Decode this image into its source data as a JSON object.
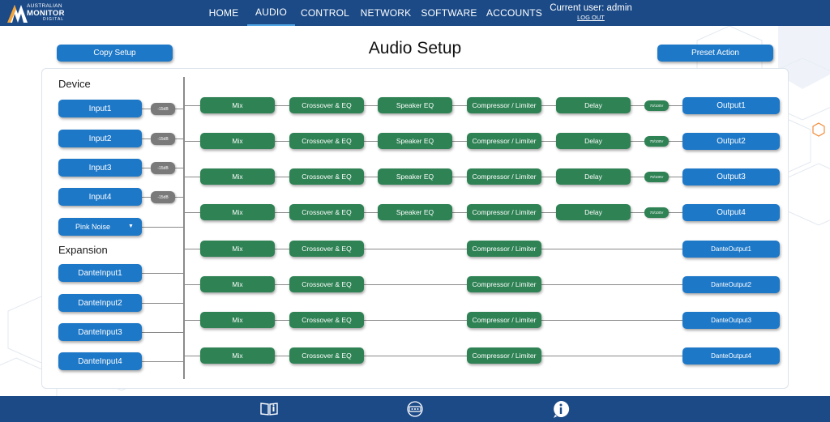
{
  "brand": {
    "line1": "AUSTRALIAN",
    "line2": "MONITOR",
    "line3": "DIGITAL"
  },
  "nav": [
    {
      "label": "HOME",
      "active": false
    },
    {
      "label": "AUDIO",
      "active": true
    },
    {
      "label": "CONTROL",
      "active": false
    },
    {
      "label": "NETWORK",
      "active": false
    },
    {
      "label": "SOFTWARE",
      "active": false
    },
    {
      "label": "ACCOUNTS",
      "active": false
    }
  ],
  "user": {
    "current": "Current user: admin",
    "logout": "LOG OUT"
  },
  "page": {
    "title": "Audio Setup",
    "copy_setup": "Copy Setup",
    "preset_action": "Preset Action"
  },
  "device": {
    "heading": "Device",
    "inputs": [
      {
        "label": "Input1",
        "gain": "-15dB"
      },
      {
        "label": "Input2",
        "gain": "-15dB"
      },
      {
        "label": "Input3",
        "gain": "-15dB"
      },
      {
        "label": "Input4",
        "gain": "-15dB"
      }
    ],
    "pink_noise": "Pink Noise"
  },
  "expansion": {
    "heading": "Expansion",
    "inputs": [
      "DanteInput1",
      "DanteInput2",
      "DanteInput3",
      "DanteInput4"
    ]
  },
  "channels": [
    {
      "mix": "Mix",
      "xover": "Crossover & EQ",
      "spk": "Speaker EQ",
      "comp": "Compressor / Limiter",
      "delay": "Delay",
      "vol": "70/100V",
      "output": "Output1"
    },
    {
      "mix": "Mix",
      "xover": "Crossover & EQ",
      "spk": "Speaker EQ",
      "comp": "Compressor / Limiter",
      "delay": "Delay",
      "vol": "70/100V",
      "output": "Output2"
    },
    {
      "mix": "Mix",
      "xover": "Crossover & EQ",
      "spk": "Speaker EQ",
      "comp": "Compressor / Limiter",
      "delay": "Delay",
      "vol": "70/100V",
      "output": "Output3"
    },
    {
      "mix": "Mix",
      "xover": "Crossover & EQ",
      "spk": "Speaker EQ",
      "comp": "Compressor / Limiter",
      "delay": "Delay",
      "vol": "70/100V",
      "output": "Output4"
    },
    {
      "mix": "Mix",
      "xover": "Crossover & EQ",
      "comp": "Compressor / Limiter",
      "output": "DanteOutput1"
    },
    {
      "mix": "Mix",
      "xover": "Crossover & EQ",
      "comp": "Compressor / Limiter",
      "output": "DanteOutput2"
    },
    {
      "mix": "Mix",
      "xover": "Crossover & EQ",
      "comp": "Compressor / Limiter",
      "output": "DanteOutput3"
    },
    {
      "mix": "Mix",
      "xover": "Crossover & EQ",
      "comp": "Compressor / Limiter",
      "output": "DanteOutput4"
    }
  ],
  "footer": {
    "icons": [
      "manual-book-icon",
      "network-device-icon",
      "info-icon"
    ]
  },
  "colors": {
    "navbar": "#1b4a87",
    "accent_blue": "#1d78c8",
    "dsp_green": "#2e8254",
    "gain_grey": "#7a7a7a",
    "active_underline": "#4fa3e3"
  }
}
